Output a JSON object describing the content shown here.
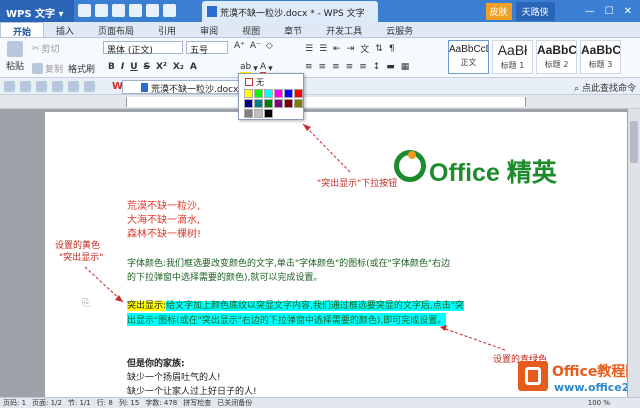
{
  "app": {
    "name": "WPS 文字",
    "doc_tab_title": "荒漠不缺一粒沙.docx * - WPS 文字",
    "skin_label": "皮肤",
    "user_label": "天路侠"
  },
  "menu": {
    "tabs": [
      "开始",
      "插入",
      "页面布局",
      "引用",
      "审阅",
      "视图",
      "章节",
      "开发工具",
      "云服务"
    ]
  },
  "ribbon": {
    "paste": "粘贴",
    "cut": "剪切",
    "copy": "复制",
    "format_painter": "格式刷",
    "font_name": "黑体 (正文)",
    "font_size": "五号",
    "styles": [
      {
        "preview": "AaBbCcDd",
        "name": "正文"
      },
      {
        "preview": "AaBł",
        "name": "标题 1"
      },
      {
        "preview": "AaBbC",
        "name": "标题 2"
      },
      {
        "preview": "AaBbC",
        "name": "标题 3"
      }
    ]
  },
  "quickbar": {
    "doc_name": "荒漠不缺一粒沙.docx",
    "right_label": "点此查找命令"
  },
  "palette": {
    "none_label": "无",
    "colors": [
      "#ffff00",
      "#00ff00",
      "#00ffff",
      "#ff00ff",
      "#0000ff",
      "#ff0000",
      "#000080",
      "#008080",
      "#008000",
      "#800080",
      "#800000",
      "#808000",
      "#808080",
      "#c0c0c0",
      "#000000"
    ]
  },
  "document": {
    "logo_text": "Office 精英",
    "annotation_top": "\"突出显示\"下拉按钮",
    "annotation_left_1": "设置的黄色",
    "annotation_left_2": "\"突出显示\"",
    "annotation_right_1": "设置的青绿色",
    "poem": [
      "荒漠不缺一粒沙,",
      "大海不缺一滴水,",
      "森林不缺一棵树!"
    ],
    "para1_line1": "字体颜色:我们框选要改变颜色的文字,单击\"字体颜色\"的图标(或在\"字体颜色\"右边",
    "para1_line2": "的下拉弹窗中选择需要的颜色),就可以完成设置。",
    "para2_label": "突出显示:",
    "para2_line1_rest": "给文字加上颜色底纹以突显文字内容,我们通过框选要突显的文字后,点击\"突",
    "para2_line2": "出显示\"图标(或在\"突出显示\"右边的下拉弹窗中选择需要的颜色),即可完成设置。",
    "lines_bottom": [
      "但是你的家族:",
      "缺少一个扬眉吐气的人!",
      "缺少一个让家人过上好日子的人!"
    ],
    "watermark_1": "Office教程网",
    "watermark_2": "www.office26.com"
  },
  "status": {
    "page": "页码: 1",
    "pages": "页面: 1/2",
    "section": "节: 1/1",
    "row": "行: 8",
    "col": "列: 15",
    "words": "字数: 478",
    "spell": "拼写检查",
    "backup": "已关闭备份",
    "zoom": "100 %"
  }
}
